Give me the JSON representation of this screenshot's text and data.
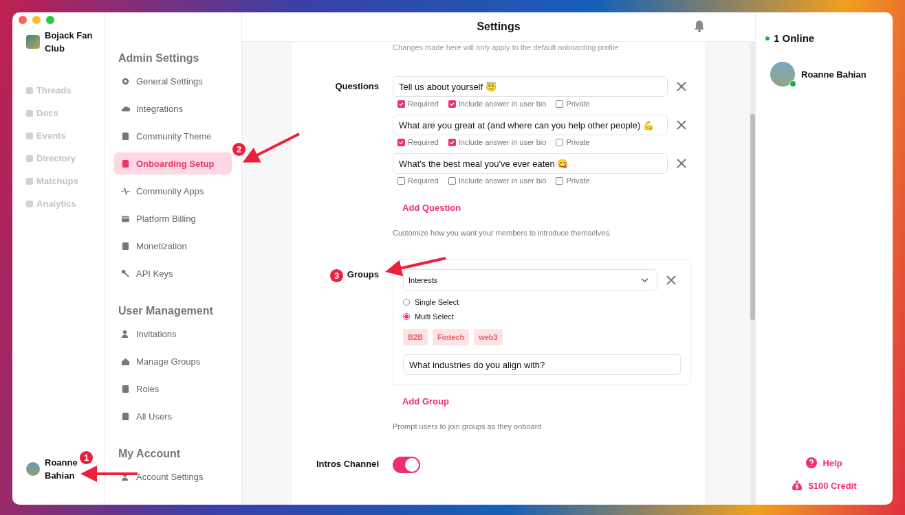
{
  "community": {
    "name": "Bojack Fan Club"
  },
  "rail": {
    "items": [
      {
        "label": "Threads"
      },
      {
        "label": "Docs"
      },
      {
        "label": "Events"
      },
      {
        "label": "Directory"
      },
      {
        "label": "Matchups"
      },
      {
        "label": "Analytics"
      }
    ],
    "user": {
      "name": "Roanne Bahian"
    }
  },
  "settings_nav": {
    "sections": [
      {
        "title": "Admin Settings",
        "items": [
          {
            "label": "General Settings",
            "selected": false
          },
          {
            "label": "Integrations",
            "selected": false
          },
          {
            "label": "Community Theme",
            "selected": false
          },
          {
            "label": "Onboarding Setup",
            "selected": true
          },
          {
            "label": "Community Apps",
            "selected": false
          },
          {
            "label": "Platform Billing",
            "selected": false
          },
          {
            "label": "Monetization",
            "selected": false
          },
          {
            "label": "API Keys",
            "selected": false
          }
        ]
      },
      {
        "title": "User Management",
        "items": [
          {
            "label": "Invitations",
            "selected": false
          },
          {
            "label": "Manage Groups",
            "selected": false
          },
          {
            "label": "Roles",
            "selected": false
          },
          {
            "label": "All Users",
            "selected": false
          }
        ]
      },
      {
        "title": "My Account",
        "items": [
          {
            "label": "Account Settings",
            "selected": false
          }
        ]
      }
    ]
  },
  "header": {
    "title": "Settings"
  },
  "content": {
    "note": "Changes made here will only apply to the default onboarding profile",
    "questions": {
      "label": "Questions",
      "items": [
        {
          "text": "Tell us about yourself 😇",
          "options": [
            {
              "label": "Required",
              "checked": true
            },
            {
              "label": "Include answer in user bio",
              "checked": true
            },
            {
              "label": "Private",
              "checked": false
            }
          ]
        },
        {
          "text": "What are you great at (and where can you help other people) 💪",
          "options": [
            {
              "label": "Required",
              "checked": true
            },
            {
              "label": "Include answer in user bio",
              "checked": true
            },
            {
              "label": "Private",
              "checked": false
            }
          ]
        },
        {
          "text": "What's the best meal you've ever eaten 😋",
          "options": [
            {
              "label": "Required",
              "checked": false
            },
            {
              "label": "Include answer in user bio",
              "checked": false
            },
            {
              "label": "Private",
              "checked": false
            }
          ]
        }
      ],
      "add_label": "Add Question",
      "hint": "Customize how you want your members to introduce themselves."
    },
    "groups": {
      "label": "Groups",
      "group": {
        "value": "Interests",
        "modes": [
          {
            "label": "Single Select",
            "selected": false
          },
          {
            "label": "Multi Select",
            "selected": true
          }
        ],
        "tags": [
          "B2B",
          "Fintech",
          "web3"
        ],
        "prompt": "What industries do you align with?"
      },
      "add_label": "Add Group",
      "hint": "Prompt users to join groups as they onboard"
    },
    "intros": {
      "label": "Intros Channel",
      "on": true
    }
  },
  "online": {
    "title": "1 Online",
    "members": [
      {
        "name": "Roanne Bahian"
      }
    ]
  },
  "footer_links": [
    {
      "label": "Help",
      "kind": "help"
    },
    {
      "label": "$100 Credit",
      "kind": "credit"
    }
  ],
  "annotations": [
    {
      "number": "1"
    },
    {
      "number": "2"
    },
    {
      "number": "3"
    }
  ]
}
